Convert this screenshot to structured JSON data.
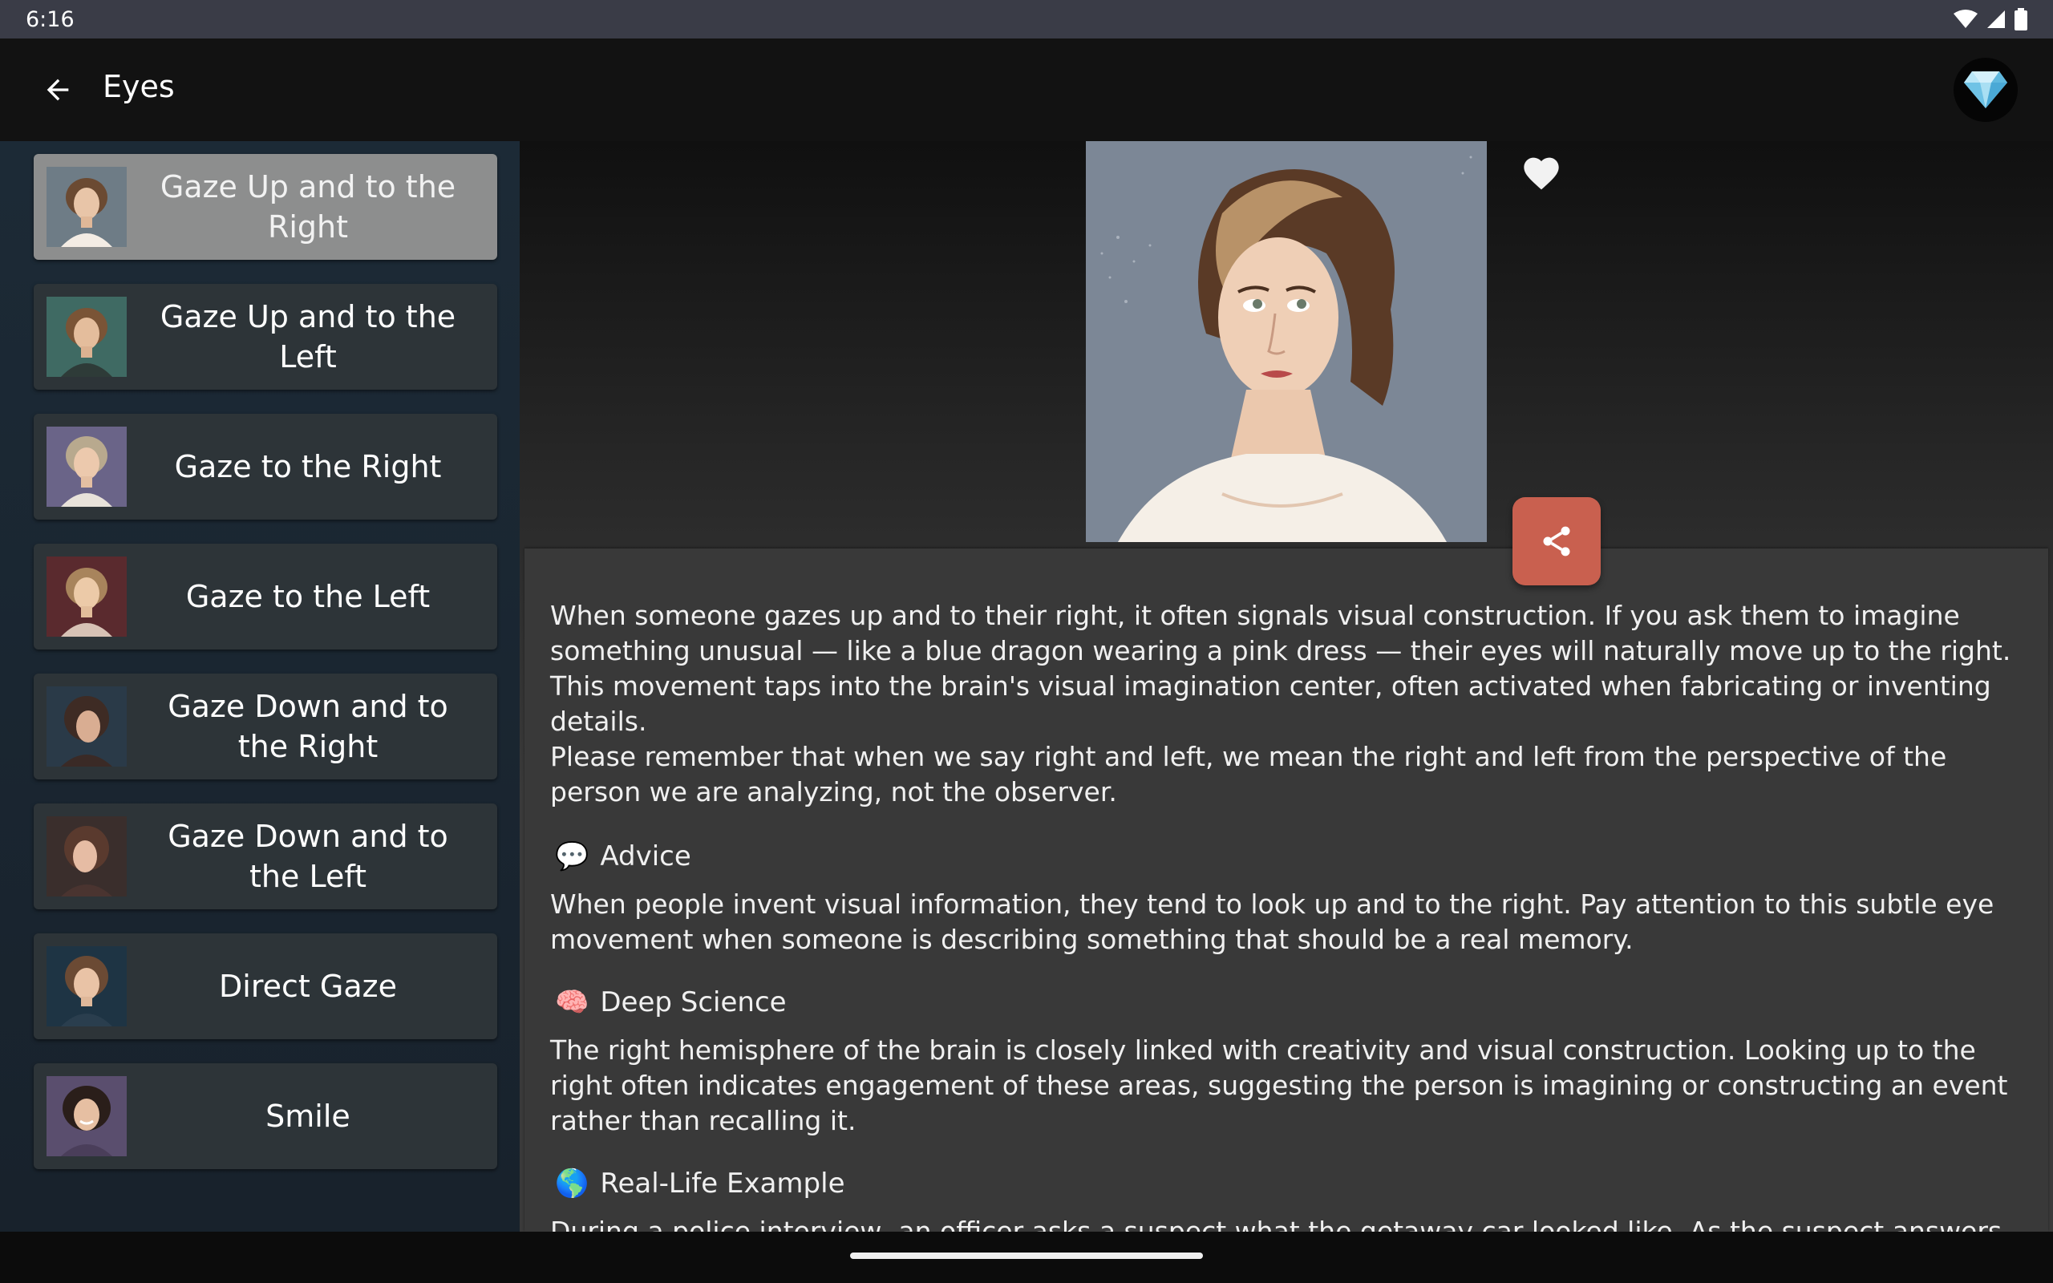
{
  "status_bar": {
    "time": "6:16"
  },
  "app_bar": {
    "title": "Eyes"
  },
  "sidebar": {
    "items": [
      {
        "label": "Gaze Up and to the Right",
        "active": true
      },
      {
        "label": "Gaze Up and to the Left",
        "active": false
      },
      {
        "label": "Gaze to the Right",
        "active": false
      },
      {
        "label": "Gaze to the Left",
        "active": false
      },
      {
        "label": "Gaze Down and to the Right",
        "active": false
      },
      {
        "label": "Gaze Down and to the Left",
        "active": false
      },
      {
        "label": "Direct Gaze",
        "active": false
      },
      {
        "label": "Smile",
        "active": false
      }
    ]
  },
  "content": {
    "intro": "When someone gazes up and to their right, it often signals visual construction. If you ask them to imagine something unusual — like a blue dragon wearing a pink dress — their eyes will naturally move up to the right. This movement taps into the brain's visual imagination center, often activated when fabricating or inventing details.",
    "note": "Please remember that when we say right and left, we mean the right and left from the perspective of the person we are analyzing, not the observer.",
    "advice_title": "Advice",
    "advice_icon": "💬",
    "advice_text": "When people invent visual information, they tend to look up and to the right. Pay attention to this subtle eye movement when someone is describing something that should be a real memory.",
    "science_title": "Deep Science",
    "science_icon": "🧠",
    "science_text": "The right hemisphere of the brain is closely linked with creativity and visual construction. Looking up to the right often indicates engagement of these areas, suggesting the person is imagining or constructing an event rather than recalling it.",
    "example_title": "Real-Life Example",
    "example_icon": "🌎",
    "example_text": "During a police interview, an officer asks a suspect what the getaway car looked like. As the suspect answers, he"
  },
  "colors": {
    "accent_share": "#c9604f",
    "active_item": "#8d8e8e",
    "item_bg": "#2d3438"
  }
}
